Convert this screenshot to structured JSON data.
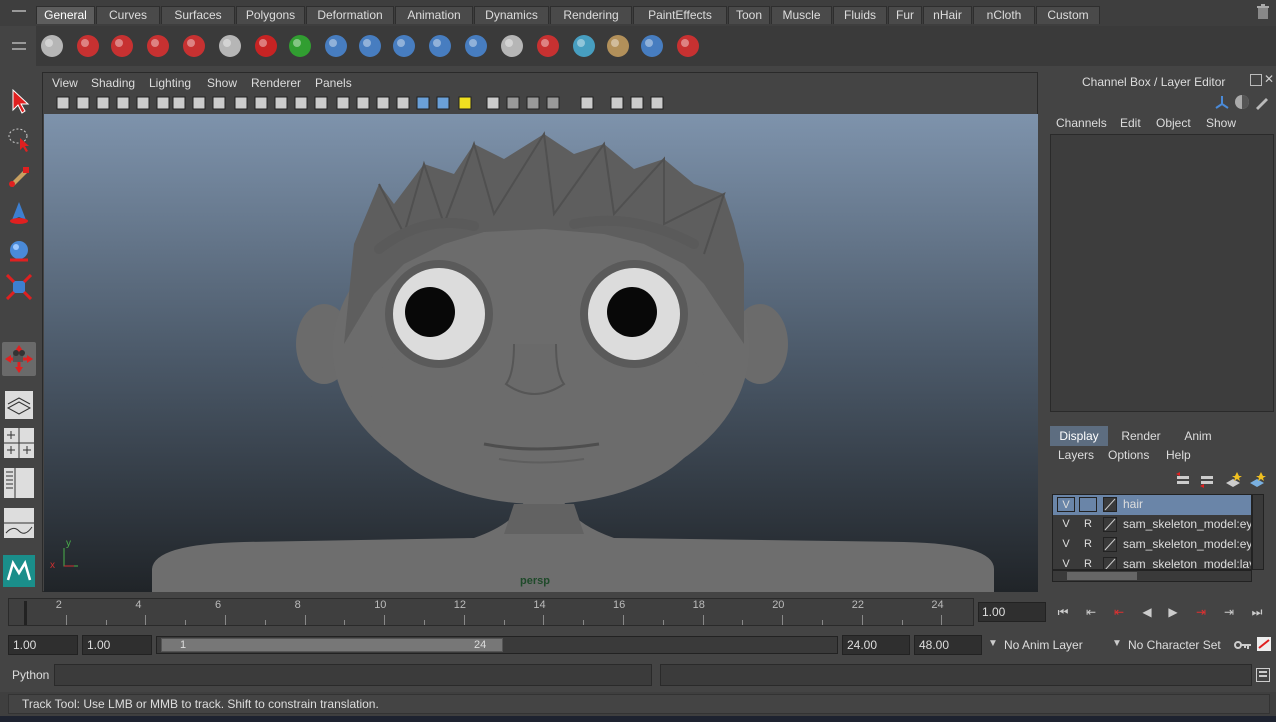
{
  "shelf": {
    "tabs": [
      "General",
      "Curves",
      "Surfaces",
      "Polygons",
      "Deformation",
      "Animation",
      "Dynamics",
      "Rendering",
      "PaintEffects",
      "Toon",
      "Muscle",
      "Fluids",
      "Fur",
      "nHair",
      "nCloth",
      "Custom"
    ],
    "active_tab": "General",
    "icons": [
      "clapperboard-icon",
      "help-icon",
      "render-icon",
      "ipr-render-icon",
      "render-settings-icon",
      "hypershade-icon",
      "undo-arrow-icon",
      "redo-arrow-icon",
      "sphere-icon",
      "joint-icon",
      "ik-icon",
      "skin-icon",
      "connect-icon",
      "outliner-icon",
      "deform-icon",
      "cube-icon",
      "paint-icon",
      "lattice-icon",
      "axis-icon"
    ]
  },
  "viewport": {
    "menu": [
      "View",
      "Shading",
      "Lighting",
      "Show",
      "Renderer",
      "Panels"
    ],
    "camera_label": "persp",
    "axis_x": "x",
    "axis_y": "y"
  },
  "channel_box": {
    "title": "Channel Box / Layer Editor",
    "menu": [
      "Channels",
      "Edit",
      "Object",
      "Show"
    ]
  },
  "layer_editor": {
    "tabs": [
      "Display",
      "Render",
      "Anim"
    ],
    "active_tab": "Display",
    "menu": [
      "Layers",
      "Options",
      "Help"
    ],
    "layers": [
      {
        "v": "V",
        "r": "",
        "name": "hair",
        "selected": true
      },
      {
        "v": "V",
        "r": "R",
        "name": "sam_skeleton_model:eye",
        "selected": false
      },
      {
        "v": "V",
        "r": "R",
        "name": "sam_skeleton_model:eye",
        "selected": false
      },
      {
        "v": "V",
        "r": "R",
        "name": "sam_skeleton_model:lay",
        "selected": false
      }
    ]
  },
  "timeline": {
    "ticks": [
      "2",
      "4",
      "6",
      "8",
      "10",
      "12",
      "14",
      "16",
      "18",
      "20",
      "22",
      "24"
    ],
    "current_frame": "1.00"
  },
  "range": {
    "start": "1.00",
    "playback_start": "1.00",
    "slider_start": "1",
    "slider_end": "24",
    "playback_end": "24.00",
    "end": "48.00",
    "anim_layer": "No Anim Layer",
    "character_set": "No Character Set"
  },
  "command": {
    "label": "Python"
  },
  "status": {
    "text": "Track Tool: Use LMB or MMB to track. Shift to constrain translation."
  },
  "colors": {
    "accent": "#6a85a8",
    "viewport_top": "#7e93ac",
    "viewport_bottom": "#202428"
  }
}
